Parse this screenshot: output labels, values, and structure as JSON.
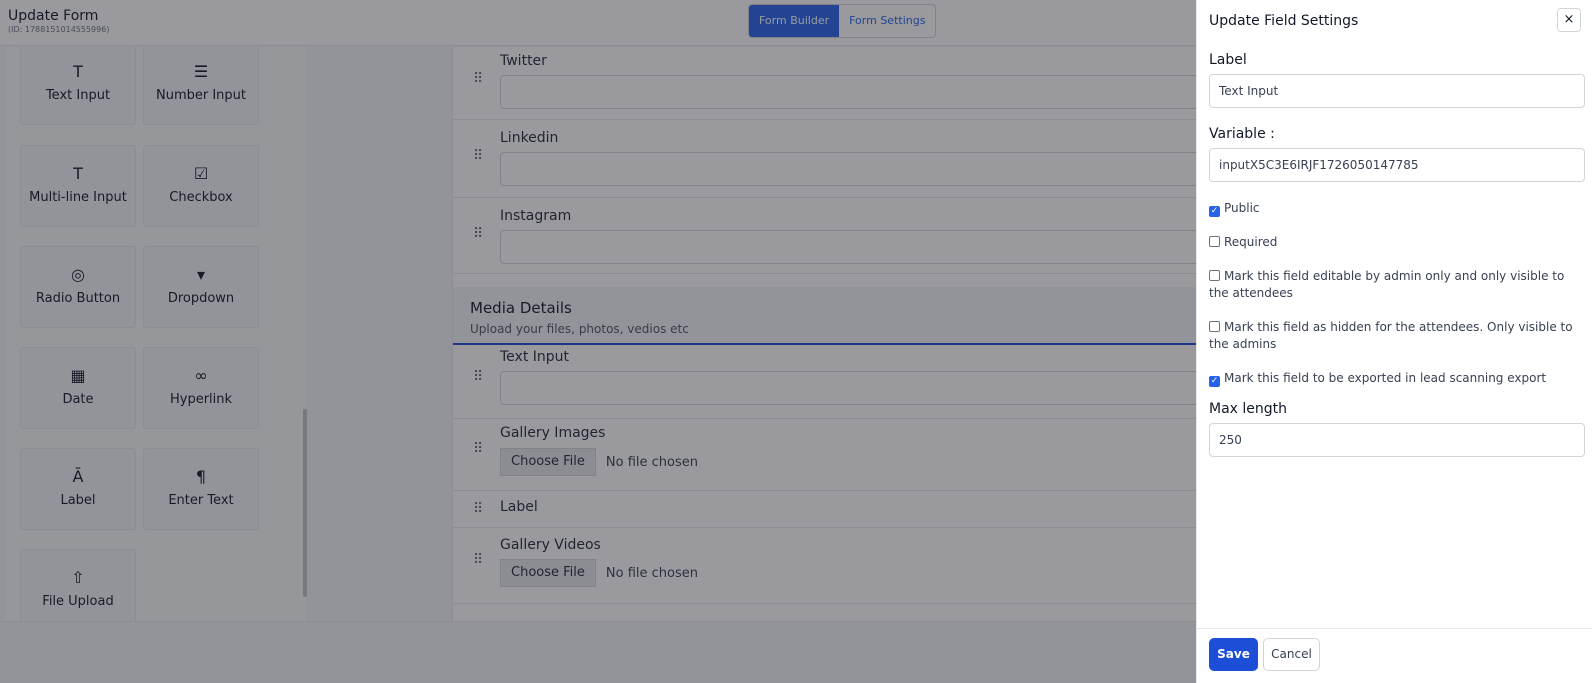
{
  "header": {
    "title": "Update Form",
    "form_id": "(ID: 17881510145559​96)",
    "tabs": [
      {
        "label": "Form Builder",
        "active": true
      },
      {
        "label": "Form Settings",
        "active": false
      }
    ]
  },
  "palette": {
    "items": [
      {
        "label": "Text Input",
        "icon": "text-icon"
      },
      {
        "label": "Number Input",
        "icon": "number-list-icon"
      },
      {
        "label": "Multi-line Input",
        "icon": "text-icon"
      },
      {
        "label": "Checkbox",
        "icon": "checkbox-icon"
      },
      {
        "label": "Radio Button",
        "icon": "radio-icon"
      },
      {
        "label": "Dropdown",
        "icon": "dropdown-icon"
      },
      {
        "label": "Date",
        "icon": "calendar-icon"
      },
      {
        "label": "Hyperlink",
        "icon": "link-icon"
      },
      {
        "label": "Label",
        "icon": "label-icon"
      },
      {
        "label": "Enter Text",
        "icon": "paragraph-icon"
      },
      {
        "label": "File Upload",
        "icon": "upload-icon"
      }
    ]
  },
  "canvas": {
    "fields_top": [
      {
        "label": "Twitter"
      },
      {
        "label": "Linkedin"
      },
      {
        "label": "Instagram"
      }
    ],
    "section": {
      "title": "Media Details",
      "subtitle": "Upload your files, photos, vedios etc"
    },
    "fields_media": {
      "text_input": {
        "label": "Text Input"
      },
      "gallery_images": {
        "label": "Gallery Images",
        "button": "Choose File",
        "status": "No file chosen"
      },
      "label_field": {
        "label": "Label"
      },
      "gallery_videos": {
        "label": "Gallery Videos",
        "button": "Choose File",
        "status": "No file chosen"
      }
    }
  },
  "panel": {
    "title": "Update Field Settings",
    "close": "×",
    "label_caption": "Label",
    "label_value": "Text Input",
    "variable_caption": "Variable :",
    "variable_value": "inputX5C3E6IRJF1726050147785",
    "checks": [
      {
        "text": "Public",
        "checked": true
      },
      {
        "text": "Required",
        "checked": false
      },
      {
        "text": "Mark this field editable by admin only and only visible to the attendees",
        "checked": false
      },
      {
        "text": "Mark this field as hidden for the attendees. Only visible to the admins",
        "checked": false
      },
      {
        "text": "Mark this field to be exported in lead scanning export",
        "checked": true
      }
    ],
    "maxlength_caption": "Max length",
    "maxlength_value": "250",
    "save": "Save",
    "cancel": "Cancel"
  }
}
